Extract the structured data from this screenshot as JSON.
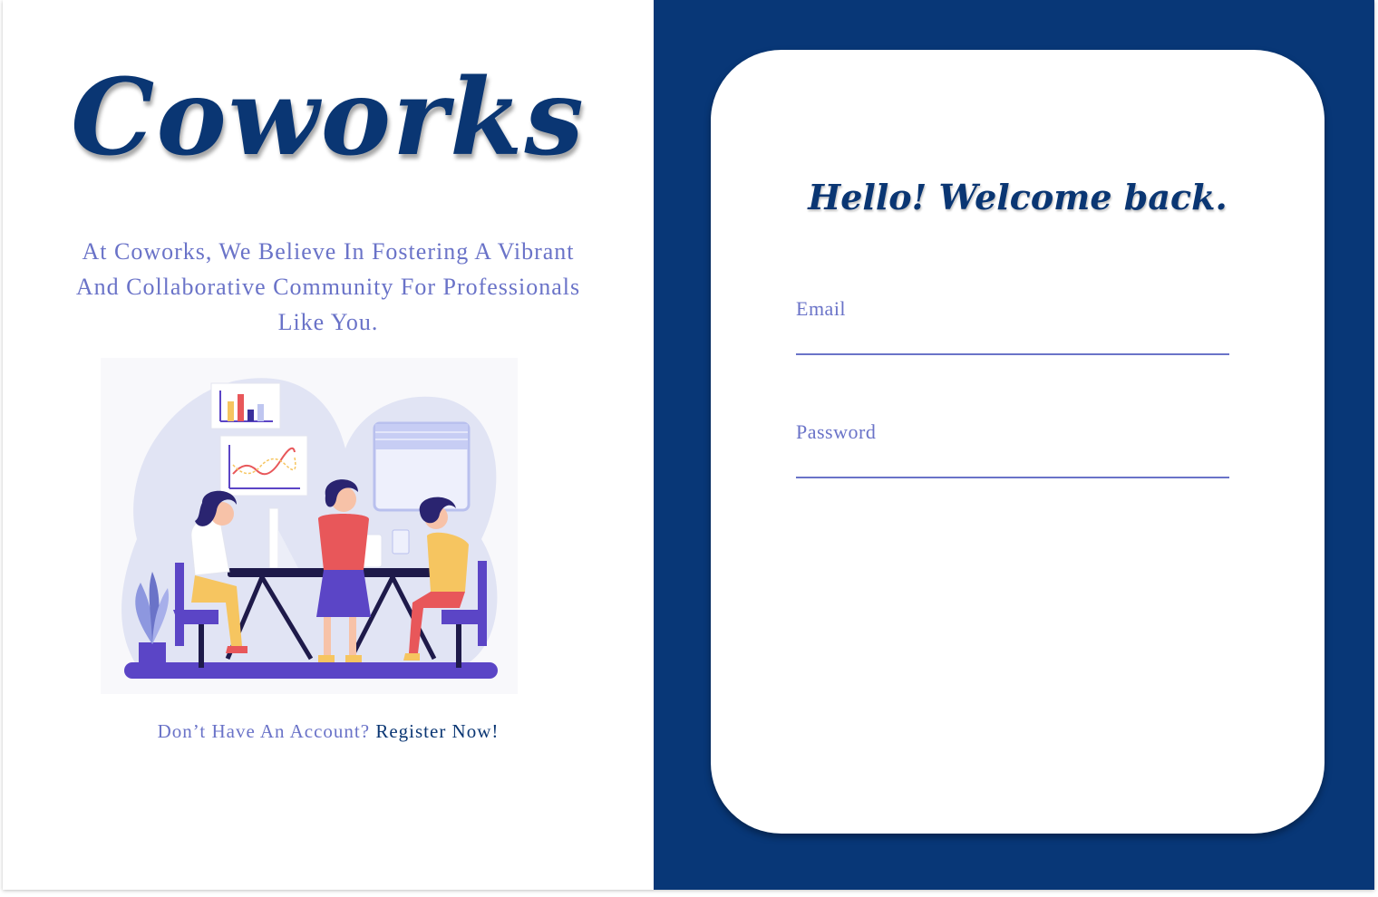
{
  "brand": {
    "name": "Coworks"
  },
  "left_panel": {
    "tagline": "At Coworks, We Believe In Fostering A Vibrant And Collaborative Community For Professionals Like You.",
    "register_prompt": "Don’t Have An Account?",
    "register_link": "Register Now!"
  },
  "login_card": {
    "heading": "Hello!  Welcome back.",
    "email_label": "Email",
    "email_value": "",
    "password_label": "Password",
    "password_value": ""
  },
  "colors": {
    "navy": "#083777",
    "text_primary": "#0a3673",
    "text_secondary": "#6a73c8",
    "illustration_purple": "#5b45c6",
    "illustration_red": "#e8575a",
    "illustration_yellow": "#f6c560"
  },
  "icons": [
    "team-meeting-illustration"
  ]
}
